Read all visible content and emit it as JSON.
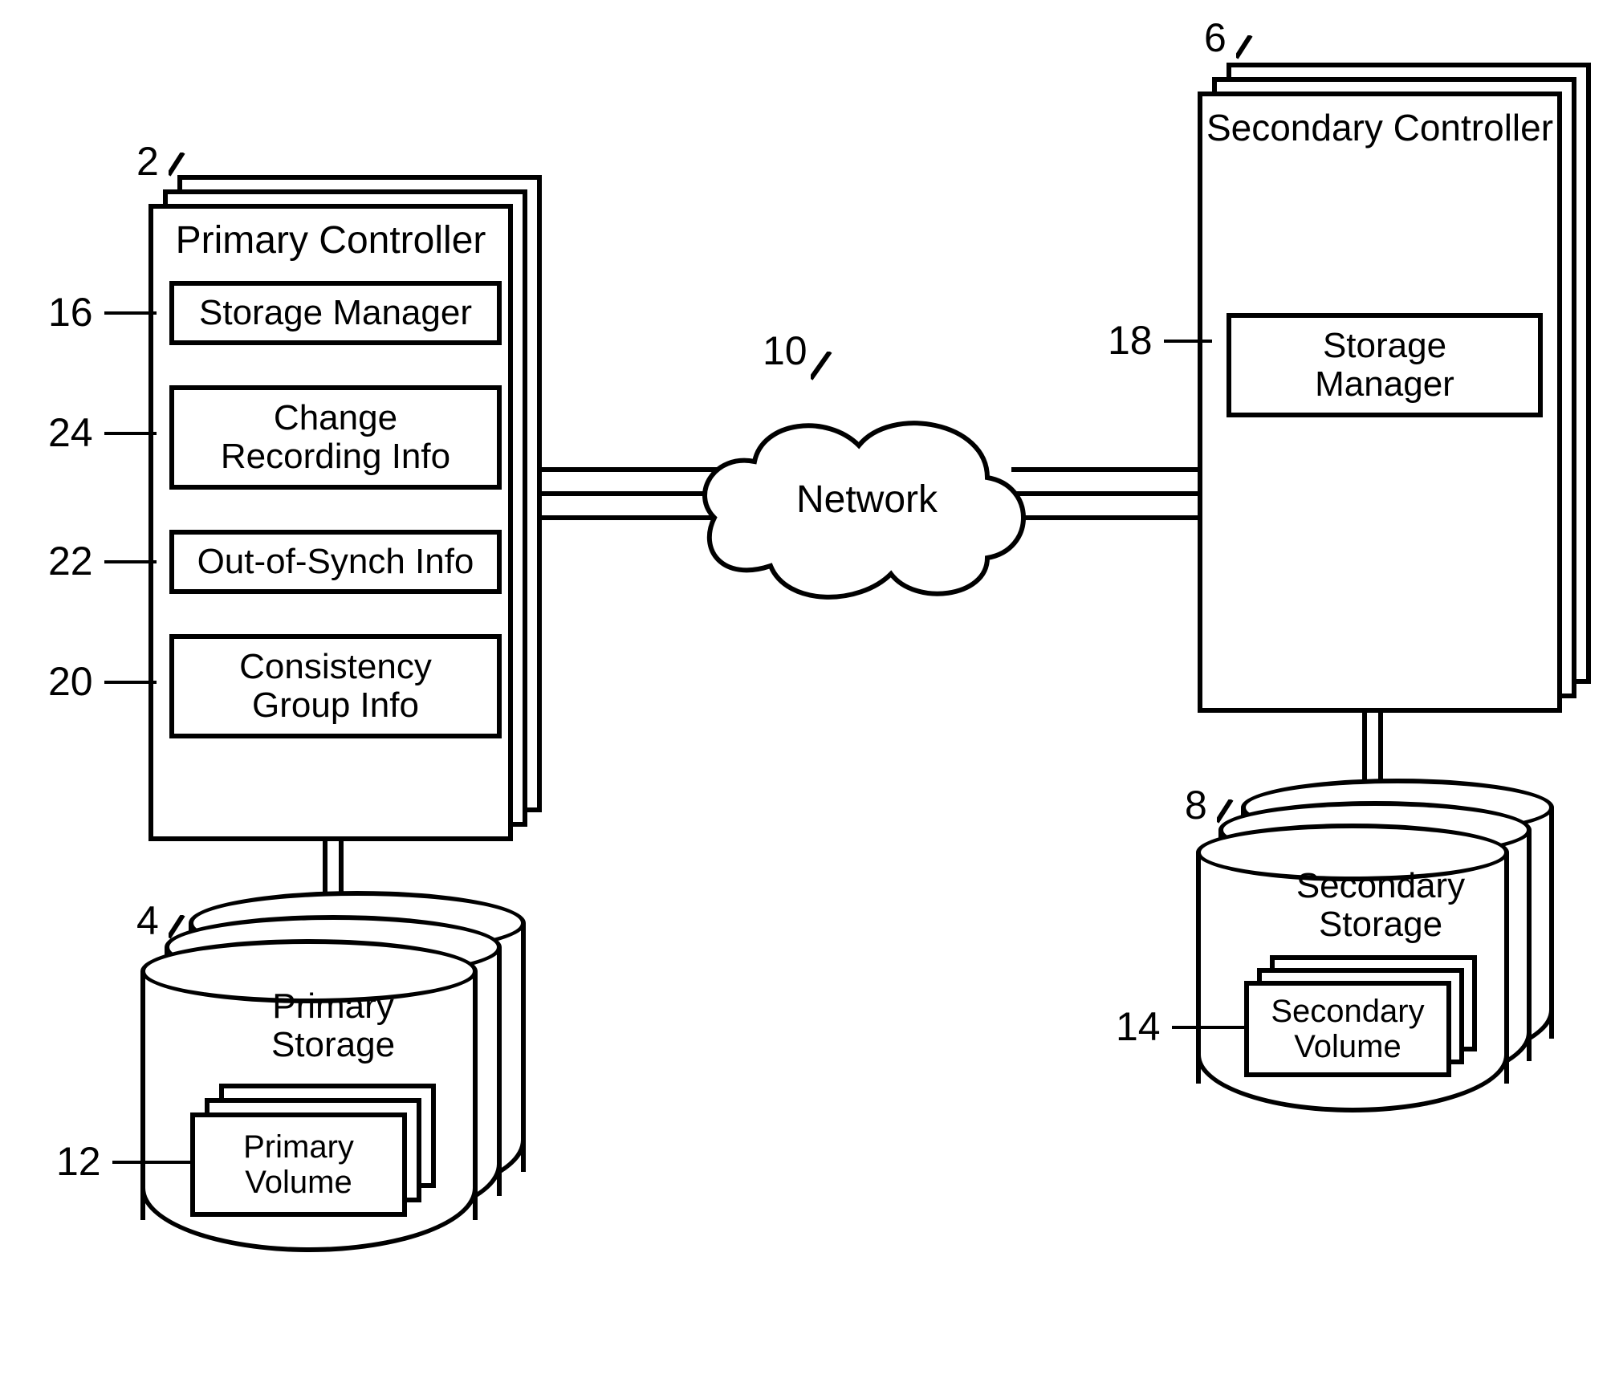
{
  "refs": {
    "primary_controller": "2",
    "primary_storage": "4",
    "secondary_controller": "6",
    "secondary_storage": "8",
    "network": "10",
    "primary_volume": "12",
    "secondary_volume": "14",
    "storage_manager_primary": "16",
    "storage_manager_secondary": "18",
    "consistency_group": "20",
    "out_of_synch": "22",
    "change_recording": "24"
  },
  "labels": {
    "primary_controller": "Primary Controller",
    "secondary_controller": "Secondary Controller",
    "storage_manager": "Storage Manager",
    "storage_manager_multiline": "Storage\nManager",
    "change_recording": "Change\nRecording Info",
    "out_of_synch": "Out-of-Synch Info",
    "consistency_group": "Consistency\nGroup Info",
    "network": "Network",
    "primary_storage": "Primary\nStorage",
    "secondary_storage": "Secondary\nStorage",
    "primary_volume": "Primary\nVolume",
    "secondary_volume": "Secondary\nVolume"
  }
}
